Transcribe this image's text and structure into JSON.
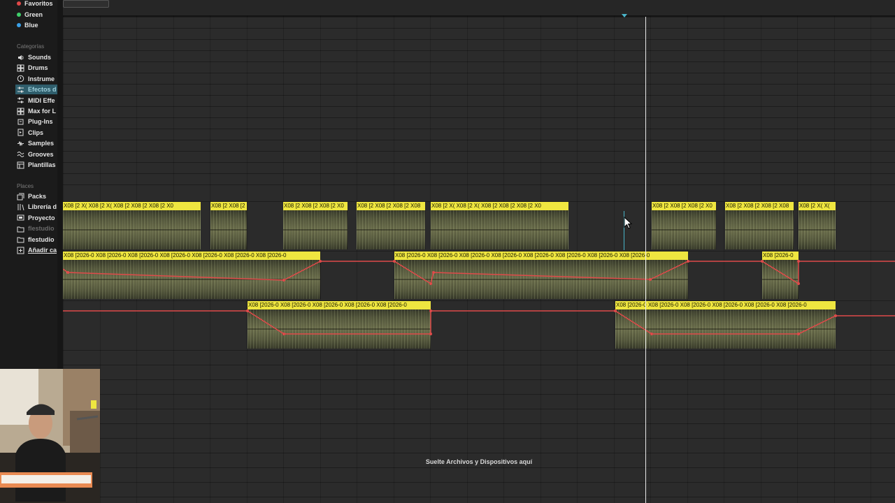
{
  "sidebar": {
    "colors": [
      {
        "label": "Favoritos",
        "color": "#e04848"
      },
      {
        "label": "Green",
        "color": "#3fcf6a"
      },
      {
        "label": "Blue",
        "color": "#3aa0e8"
      }
    ],
    "categories_header": "Categorías",
    "categories": [
      {
        "label": "Sounds",
        "icon": "speaker-icon"
      },
      {
        "label": "Drums",
        "icon": "grid-icon"
      },
      {
        "label": "Instrume",
        "icon": "clock-icon"
      },
      {
        "label": "Efectos d",
        "icon": "sliders-icon",
        "selected": true
      },
      {
        "label": "MIDI Effe",
        "icon": "sliders-icon"
      },
      {
        "label": "Max for L",
        "icon": "grid-icon"
      },
      {
        "label": "Plug-Ins",
        "icon": "plug-icon"
      },
      {
        "label": "Clips",
        "icon": "clip-icon"
      },
      {
        "label": "Samples",
        "icon": "waveform-icon"
      },
      {
        "label": "Grooves",
        "icon": "wave-icon"
      },
      {
        "label": "Plantillas",
        "icon": "template-icon"
      }
    ],
    "places_header": "Places",
    "places": [
      {
        "label": "Packs",
        "icon": "packs-icon"
      },
      {
        "label": "Librería d",
        "icon": "library-icon"
      },
      {
        "label": "Proyecto",
        "icon": "project-icon"
      },
      {
        "label": "flestudio",
        "icon": "folder-icon",
        "dim": true
      },
      {
        "label": "flestudio",
        "icon": "folder-icon"
      },
      {
        "label": "Añadir ca",
        "icon": "add-folder-icon",
        "underline": true
      }
    ]
  },
  "tracks": {
    "track1_clips": [
      {
        "label": "X08 [2 X( X08 [2 X( X08 [2 X08 [2 X08 [2 X0"
      },
      {
        "label": "X08 [2 X08 [2"
      },
      {
        "label": "X08 [2 X08 [2 X08 [2 X0"
      },
      {
        "label": "X08 [2 X08 [2 X08 [2 X08"
      },
      {
        "label": "X08 [2 X( X08 [2 X( X08 [2 X08 [2 X08 [2 X0"
      },
      {
        "label": "X08 [2 X08 [2 X08 [2 X0"
      },
      {
        "label": "X08 [2 X08 [2 X08 [2 X08"
      },
      {
        "label": "X08 [2 X( X("
      }
    ],
    "track2_clips": [
      {
        "label": "X08 [2026-0 X08 [2026-0 X08 [2026-0 X08 [2026-0 X08 [2026-0 X08 [2026-0 X08 [2026-0"
      },
      {
        "label": "X08 [2026-0 X08 [2026-0 X08 [2026-0 X08 [2026-0 X08 [2026-0 X08 [2026-0 X08 [2026-0 X08 [2026-0"
      },
      {
        "label": "X08 [2026-0"
      }
    ],
    "track3_clips": [
      {
        "label": "X08 [2026-0 X08 [2026-0 X08 [2026-0 X08 [2026-0 X08 [2026-0"
      },
      {
        "label": "X08 [2026-0 X08 [2026-0 X08 [2026-0 X08 [2026-0 X08 [2026-0 X08 [2026-0"
      }
    ],
    "automation_color": "#e04a4a",
    "clip_color": "#efe640"
  },
  "drop_hint": "Suelte Archivos y Dispositivos aquí"
}
